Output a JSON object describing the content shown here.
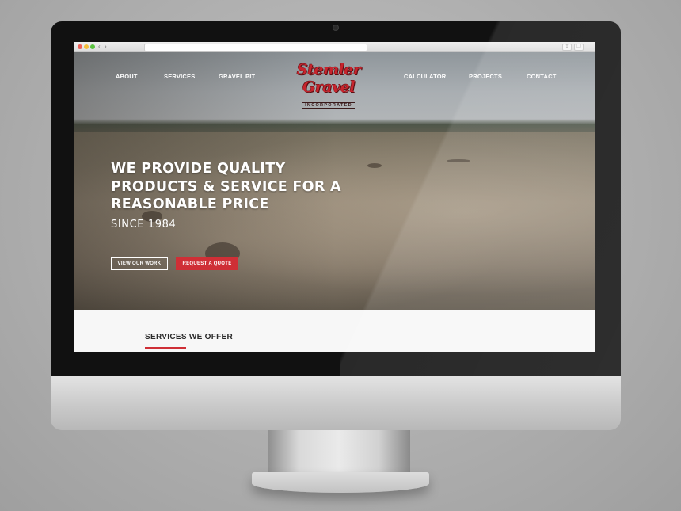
{
  "site": {
    "logo": {
      "name": "Stemler Gravel",
      "tagline": "INCORPORATED"
    },
    "nav": {
      "left": [
        "ABOUT",
        "SERVICES",
        "GRAVEL PIT"
      ],
      "right": [
        "CALCULATOR",
        "PROJECTS",
        "CONTACT"
      ]
    },
    "hero": {
      "headline": "WE PROVIDE QUALITY PRODUCTS & SERVICE FOR A REASONABLE PRICE",
      "since": "SINCE 1984",
      "buttons": {
        "view_work": "VIEW OUR WORK",
        "request_quote": "REQUEST A QUOTE"
      }
    },
    "services": {
      "title": "SERVICES WE OFFER"
    }
  },
  "browser": {
    "back": "‹",
    "forward": "›",
    "share": "⇪",
    "tabs": "❐"
  },
  "colors": {
    "accent": "#cf2f36",
    "logo": "#c7242d",
    "services_bg": "#f7f7f7"
  }
}
